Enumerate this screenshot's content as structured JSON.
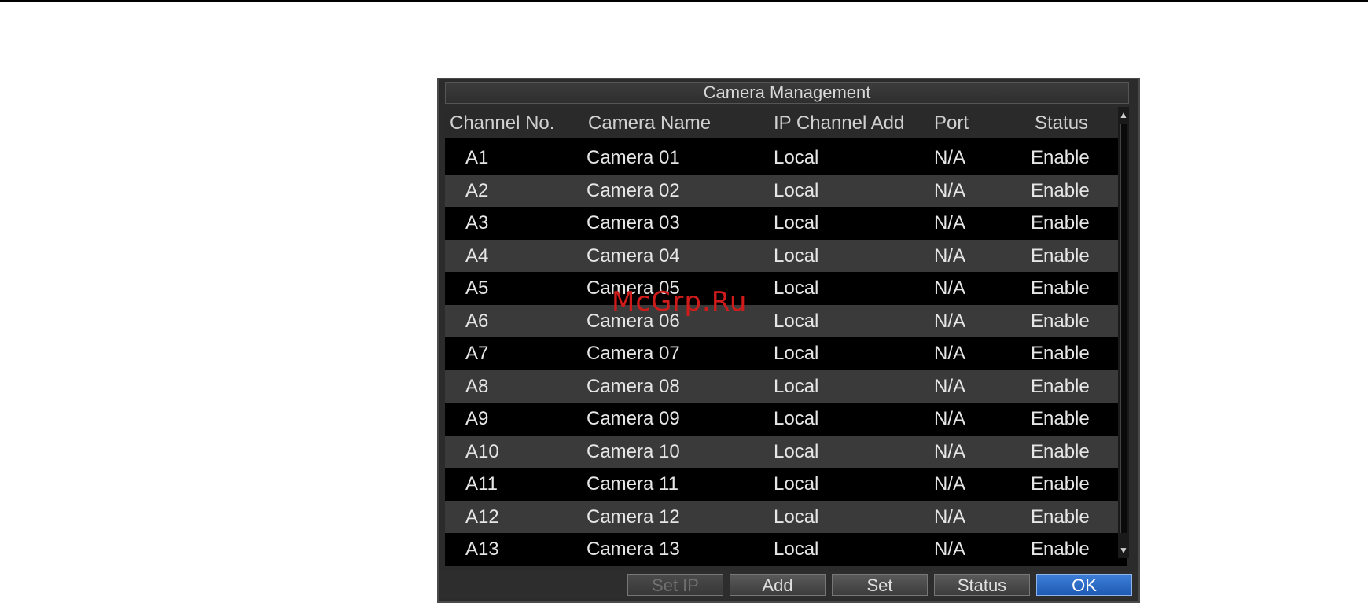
{
  "dialog": {
    "title": "Camera Management",
    "columns": [
      "Channel No.",
      "Camera Name",
      "IP Channel Add",
      "Port",
      "Status"
    ],
    "rows": [
      {
        "channel": "A1",
        "name": "Camera 01",
        "ip": "Local",
        "port": "N/A",
        "status": "Enable"
      },
      {
        "channel": "A2",
        "name": "Camera 02",
        "ip": "Local",
        "port": "N/A",
        "status": "Enable"
      },
      {
        "channel": "A3",
        "name": "Camera 03",
        "ip": "Local",
        "port": "N/A",
        "status": "Enable"
      },
      {
        "channel": "A4",
        "name": "Camera 04",
        "ip": "Local",
        "port": "N/A",
        "status": "Enable"
      },
      {
        "channel": "A5",
        "name": "Camera 05",
        "ip": "Local",
        "port": "N/A",
        "status": "Enable"
      },
      {
        "channel": "A6",
        "name": "Camera 06",
        "ip": "Local",
        "port": "N/A",
        "status": "Enable"
      },
      {
        "channel": "A7",
        "name": "Camera 07",
        "ip": "Local",
        "port": "N/A",
        "status": "Enable"
      },
      {
        "channel": "A8",
        "name": "Camera 08",
        "ip": "Local",
        "port": "N/A",
        "status": "Enable"
      },
      {
        "channel": "A9",
        "name": "Camera 09",
        "ip": "Local",
        "port": "N/A",
        "status": "Enable"
      },
      {
        "channel": "A10",
        "name": "Camera 10",
        "ip": "Local",
        "port": "N/A",
        "status": "Enable"
      },
      {
        "channel": "A11",
        "name": "Camera 11",
        "ip": "Local",
        "port": "N/A",
        "status": "Enable"
      },
      {
        "channel": "A12",
        "name": "Camera 12",
        "ip": "Local",
        "port": "N/A",
        "status": "Enable"
      },
      {
        "channel": "A13",
        "name": "Camera 13",
        "ip": "Local",
        "port": "N/A",
        "status": "Enable"
      }
    ],
    "buttons": {
      "setup": "Set IP",
      "add": "Add",
      "set": "Set",
      "status": "Status",
      "ok": "OK"
    },
    "scroll_up_icon": "arrow-up-icon",
    "scroll_down_icon": "arrow-down-icon"
  },
  "watermark": "McGrp.Ru",
  "colors": {
    "dialog_bg": "#2b2b2b",
    "row_dark": "#000000",
    "row_light": "#3a3a3a",
    "ok_button": "#2a6bc8",
    "watermark": "#d01b1b"
  }
}
